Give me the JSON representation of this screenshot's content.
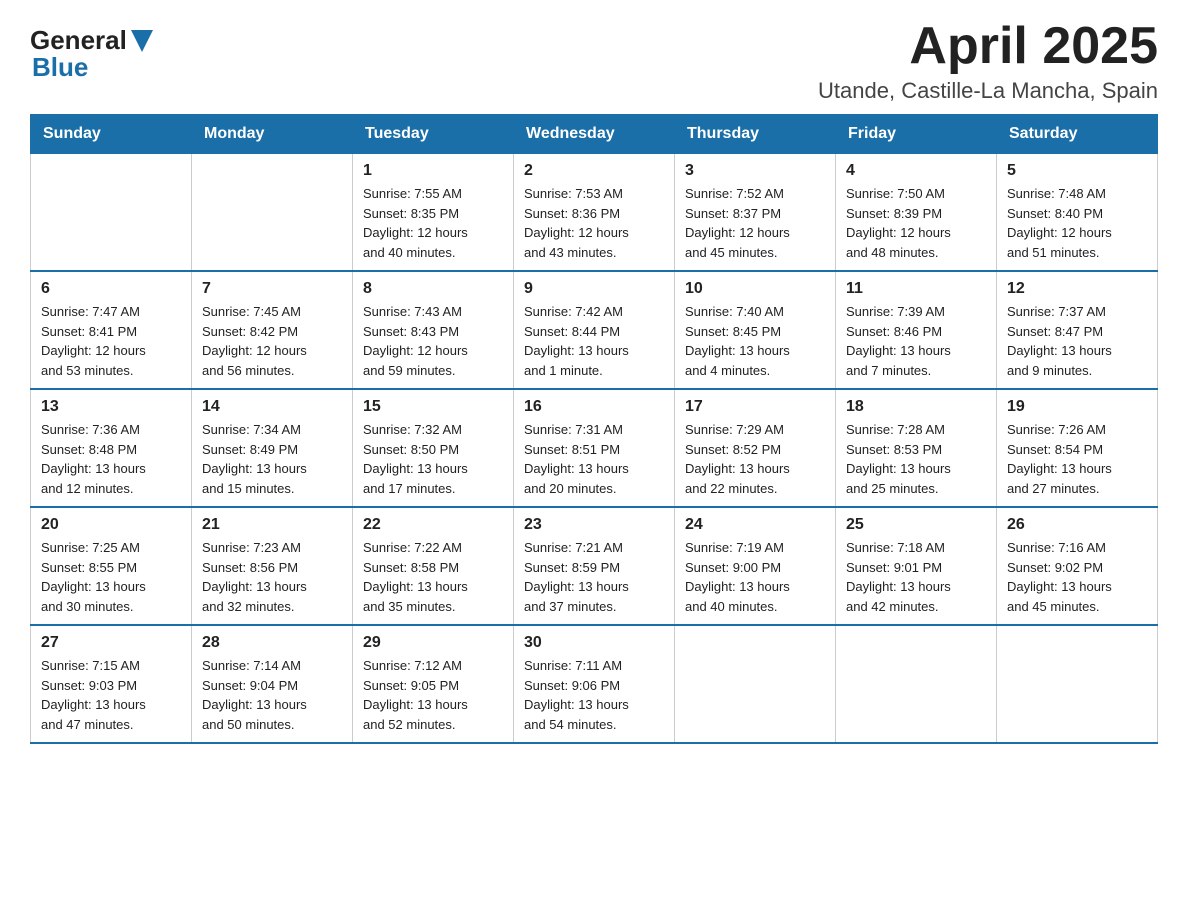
{
  "header": {
    "logo": {
      "general": "General",
      "blue": "Blue"
    },
    "title": "April 2025",
    "location": "Utande, Castille-La Mancha, Spain"
  },
  "columns": [
    "Sunday",
    "Monday",
    "Tuesday",
    "Wednesday",
    "Thursday",
    "Friday",
    "Saturday"
  ],
  "weeks": [
    [
      {
        "day": "",
        "info": ""
      },
      {
        "day": "",
        "info": ""
      },
      {
        "day": "1",
        "info": "Sunrise: 7:55 AM\nSunset: 8:35 PM\nDaylight: 12 hours\nand 40 minutes."
      },
      {
        "day": "2",
        "info": "Sunrise: 7:53 AM\nSunset: 8:36 PM\nDaylight: 12 hours\nand 43 minutes."
      },
      {
        "day": "3",
        "info": "Sunrise: 7:52 AM\nSunset: 8:37 PM\nDaylight: 12 hours\nand 45 minutes."
      },
      {
        "day": "4",
        "info": "Sunrise: 7:50 AM\nSunset: 8:39 PM\nDaylight: 12 hours\nand 48 minutes."
      },
      {
        "day": "5",
        "info": "Sunrise: 7:48 AM\nSunset: 8:40 PM\nDaylight: 12 hours\nand 51 minutes."
      }
    ],
    [
      {
        "day": "6",
        "info": "Sunrise: 7:47 AM\nSunset: 8:41 PM\nDaylight: 12 hours\nand 53 minutes."
      },
      {
        "day": "7",
        "info": "Sunrise: 7:45 AM\nSunset: 8:42 PM\nDaylight: 12 hours\nand 56 minutes."
      },
      {
        "day": "8",
        "info": "Sunrise: 7:43 AM\nSunset: 8:43 PM\nDaylight: 12 hours\nand 59 minutes."
      },
      {
        "day": "9",
        "info": "Sunrise: 7:42 AM\nSunset: 8:44 PM\nDaylight: 13 hours\nand 1 minute."
      },
      {
        "day": "10",
        "info": "Sunrise: 7:40 AM\nSunset: 8:45 PM\nDaylight: 13 hours\nand 4 minutes."
      },
      {
        "day": "11",
        "info": "Sunrise: 7:39 AM\nSunset: 8:46 PM\nDaylight: 13 hours\nand 7 minutes."
      },
      {
        "day": "12",
        "info": "Sunrise: 7:37 AM\nSunset: 8:47 PM\nDaylight: 13 hours\nand 9 minutes."
      }
    ],
    [
      {
        "day": "13",
        "info": "Sunrise: 7:36 AM\nSunset: 8:48 PM\nDaylight: 13 hours\nand 12 minutes."
      },
      {
        "day": "14",
        "info": "Sunrise: 7:34 AM\nSunset: 8:49 PM\nDaylight: 13 hours\nand 15 minutes."
      },
      {
        "day": "15",
        "info": "Sunrise: 7:32 AM\nSunset: 8:50 PM\nDaylight: 13 hours\nand 17 minutes."
      },
      {
        "day": "16",
        "info": "Sunrise: 7:31 AM\nSunset: 8:51 PM\nDaylight: 13 hours\nand 20 minutes."
      },
      {
        "day": "17",
        "info": "Sunrise: 7:29 AM\nSunset: 8:52 PM\nDaylight: 13 hours\nand 22 minutes."
      },
      {
        "day": "18",
        "info": "Sunrise: 7:28 AM\nSunset: 8:53 PM\nDaylight: 13 hours\nand 25 minutes."
      },
      {
        "day": "19",
        "info": "Sunrise: 7:26 AM\nSunset: 8:54 PM\nDaylight: 13 hours\nand 27 minutes."
      }
    ],
    [
      {
        "day": "20",
        "info": "Sunrise: 7:25 AM\nSunset: 8:55 PM\nDaylight: 13 hours\nand 30 minutes."
      },
      {
        "day": "21",
        "info": "Sunrise: 7:23 AM\nSunset: 8:56 PM\nDaylight: 13 hours\nand 32 minutes."
      },
      {
        "day": "22",
        "info": "Sunrise: 7:22 AM\nSunset: 8:58 PM\nDaylight: 13 hours\nand 35 minutes."
      },
      {
        "day": "23",
        "info": "Sunrise: 7:21 AM\nSunset: 8:59 PM\nDaylight: 13 hours\nand 37 minutes."
      },
      {
        "day": "24",
        "info": "Sunrise: 7:19 AM\nSunset: 9:00 PM\nDaylight: 13 hours\nand 40 minutes."
      },
      {
        "day": "25",
        "info": "Sunrise: 7:18 AM\nSunset: 9:01 PM\nDaylight: 13 hours\nand 42 minutes."
      },
      {
        "day": "26",
        "info": "Sunrise: 7:16 AM\nSunset: 9:02 PM\nDaylight: 13 hours\nand 45 minutes."
      }
    ],
    [
      {
        "day": "27",
        "info": "Sunrise: 7:15 AM\nSunset: 9:03 PM\nDaylight: 13 hours\nand 47 minutes."
      },
      {
        "day": "28",
        "info": "Sunrise: 7:14 AM\nSunset: 9:04 PM\nDaylight: 13 hours\nand 50 minutes."
      },
      {
        "day": "29",
        "info": "Sunrise: 7:12 AM\nSunset: 9:05 PM\nDaylight: 13 hours\nand 52 minutes."
      },
      {
        "day": "30",
        "info": "Sunrise: 7:11 AM\nSunset: 9:06 PM\nDaylight: 13 hours\nand 54 minutes."
      },
      {
        "day": "",
        "info": ""
      },
      {
        "day": "",
        "info": ""
      },
      {
        "day": "",
        "info": ""
      }
    ]
  ]
}
